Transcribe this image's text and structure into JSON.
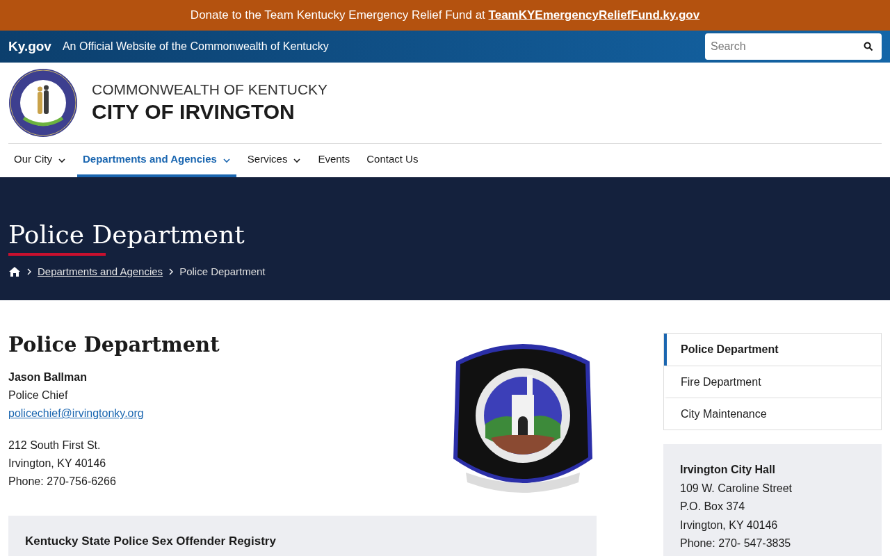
{
  "banner": {
    "text": "Donate to the Team Kentucky Emergency Relief Fund at ",
    "link": "TeamKYEmergencyReliefFund.ky.gov"
  },
  "gov_bar": {
    "brand": "Ky.gov",
    "tagline": "An Official Website of the Commonwealth of Kentucky",
    "search": {
      "placeholder": "Search"
    }
  },
  "header": {
    "subtitle": "COMMONWEALTH OF KENTUCKY",
    "title": "CITY OF IRVINGTON"
  },
  "nav": [
    {
      "label": "Our City",
      "dropdown": true,
      "selected": false
    },
    {
      "label": "Departments and Agencies",
      "dropdown": true,
      "selected": true
    },
    {
      "label": "Services",
      "dropdown": true,
      "selected": false
    },
    {
      "label": "Events",
      "dropdown": false,
      "selected": false
    },
    {
      "label": "Contact Us",
      "dropdown": false,
      "selected": false
    }
  ],
  "hero": {
    "title": "Police Department",
    "breadcrumbs": [
      {
        "label": "Departments and Agencies",
        "link": true
      },
      {
        "label": "Police Department",
        "link": false
      }
    ]
  },
  "content": {
    "title": "Police Department",
    "contact_name": "Jason Ballman",
    "contact_role": "Police Chief",
    "email": "policechief@irvingtonky.org",
    "address": [
      "212 South First St.",
      "Irvington, KY 40146",
      "Phone: 270-756-6266"
    ],
    "image": {
      "kind": "picture"
    },
    "callout_title": "Kentucky State Police Sex Offender Registry"
  },
  "sidebar": {
    "menu": [
      {
        "label": "Police Department",
        "selected": true
      },
      {
        "label": "Fire Department",
        "selected": false
      },
      {
        "label": "City Maintenance",
        "selected": false
      }
    ],
    "card": {
      "title": "Irvington City Hall",
      "lines": [
        "109 W. Caroline Street",
        "P.O. Box 374",
        "Irvington, KY 40146",
        "Phone: 270- 547-3835"
      ]
    }
  }
}
